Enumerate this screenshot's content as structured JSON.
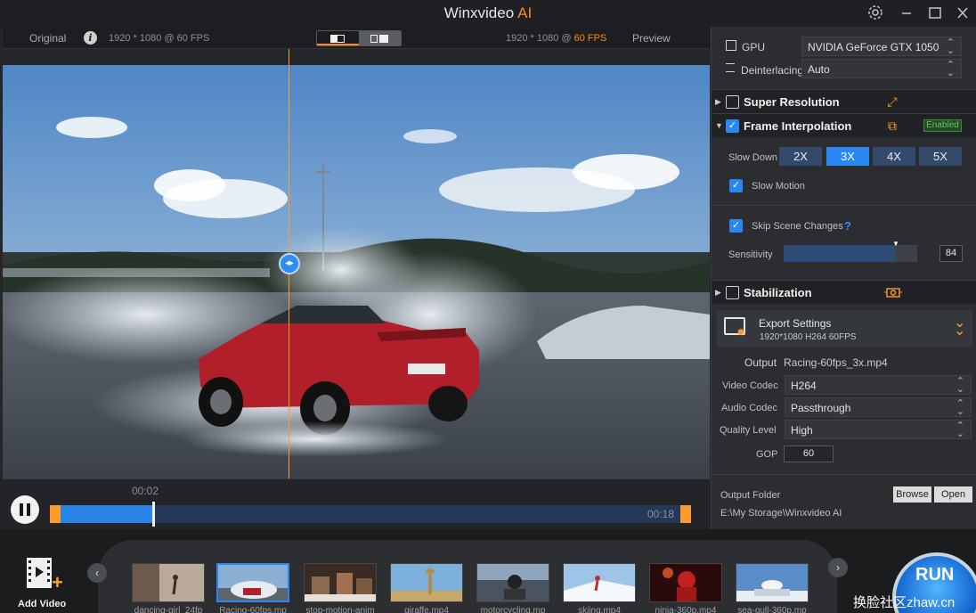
{
  "app": {
    "title": "Winxvideo",
    "title_suffix": "AI"
  },
  "compare": {
    "original_label": "Original",
    "info_icon": "i",
    "original_res": "1920 * 1080 @ 60 FPS",
    "preview_res_prefix": "1920 * 1080 @",
    "preview_fps": "60 FPS",
    "preview_label": "Preview"
  },
  "player": {
    "current_time": "00:02",
    "total_time": "00:18",
    "progress": 0.15
  },
  "right": {
    "gpu_label": "GPU",
    "gpu_value": "NVIDIA GeForce GTX 1050",
    "deinterlacing_label": "Deinterlacing",
    "deinterlacing_value": "Auto",
    "sections": {
      "super_resolution": "Super Resolution",
      "frame_interpolation": "Frame Interpolation",
      "stabilization": "Stabilization"
    },
    "enabled_badge": "Enabled",
    "slow_down_label": "Slow Down",
    "speeds": [
      "2X",
      "3X",
      "4X",
      "5X"
    ],
    "active_speed": "3X",
    "slow_motion_label": "Slow Motion",
    "skip_scene_label": "Skip Scene Changes",
    "help_mark": "?",
    "sensitivity_label": "Sensitivity",
    "sensitivity_value": "84",
    "sensitivity_level": 0.84
  },
  "export": {
    "title": "Export Settings",
    "subtitle": "1920*1080   H264   60FPS",
    "output_label": "Output",
    "output_value": "Racing-60fps_3x.mp4",
    "video_codec_label": "Video Codec",
    "video_codec_value": "H264",
    "audio_codec_label": "Audio Codec",
    "audio_codec_value": "Passthrough",
    "quality_label": "Quality Level",
    "quality_value": "High",
    "gop_label": "GOP",
    "gop_value": "60",
    "output_folder_label": "Output Folder",
    "output_folder_value": "E:\\My Storage\\Winxvideo AI",
    "browse_label": "Browse",
    "open_label": "Open"
  },
  "bottom": {
    "add_video_label": "Add Video",
    "run_label": "RUN",
    "watermark": "换脸社区zhaw.cn",
    "thumbnails": [
      "dancing-girl_24fp",
      "Racing-60fps.mp",
      "stop-motion-anim",
      "giraffe.mp4",
      "motorcycling.mp",
      "skiing.mp4",
      "ninja-360p.mp4",
      "sea-gull-360p.mp"
    ],
    "selected_index": 1
  },
  "colors": {
    "accent": "#ff8a1c",
    "blue": "#2a86f0"
  }
}
